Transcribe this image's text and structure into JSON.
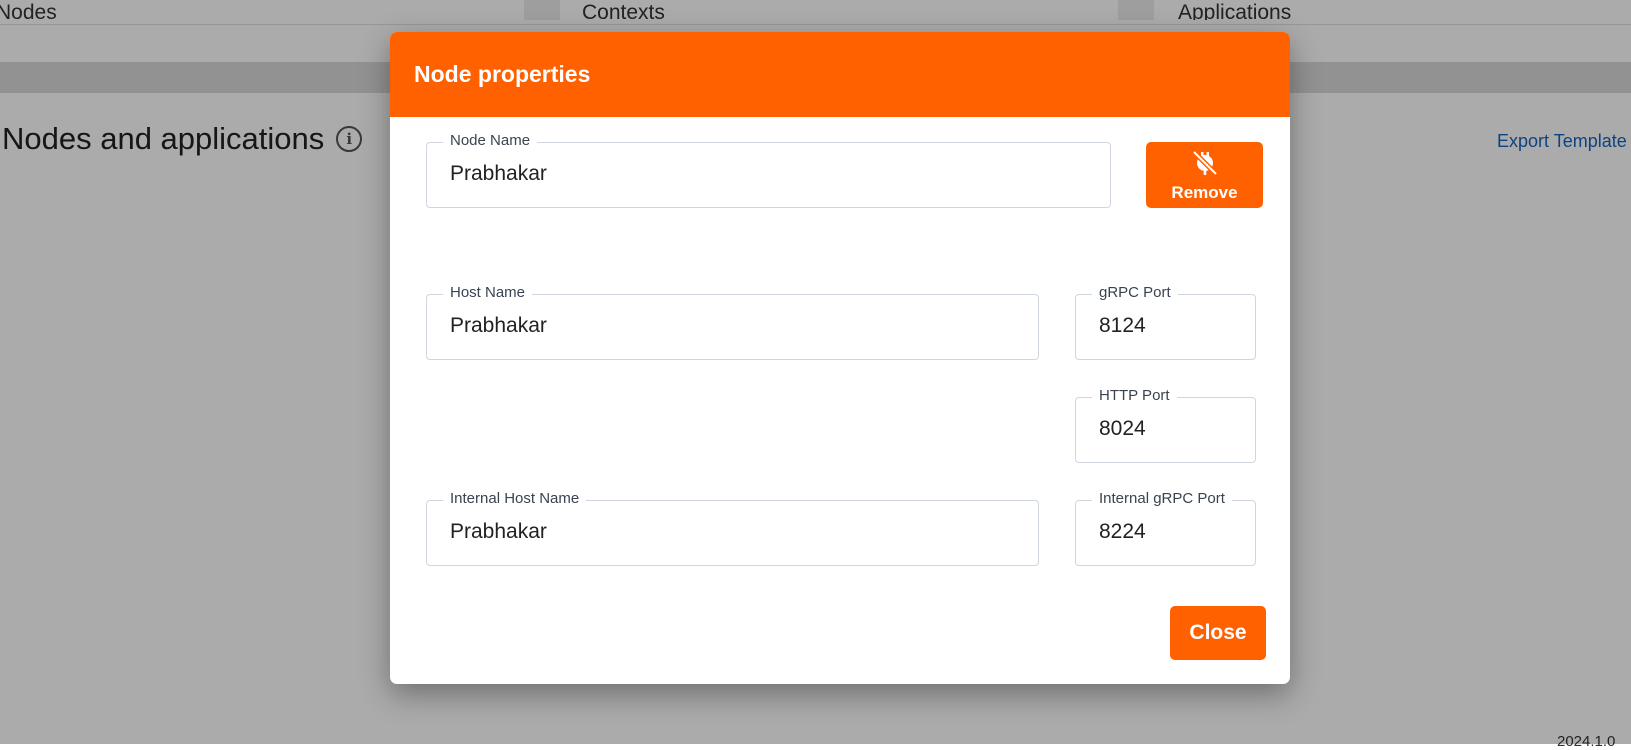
{
  "background": {
    "selectors": [
      "Nodes",
      "Contexts",
      "Applications"
    ],
    "page_title": "Nodes and applications",
    "info_icon": "info-icon",
    "export_link": "Export Template",
    "version": "2024.1.0"
  },
  "dialog": {
    "title": "Node properties",
    "remove": {
      "label": "Remove",
      "icon": "unplug-icon"
    },
    "fields": {
      "node_name": {
        "label": "Node Name",
        "value": "Prabhakar"
      },
      "host_name": {
        "label": "Host Name",
        "value": "Prabhakar"
      },
      "grpc_port": {
        "label": "gRPC Port",
        "value": "8124"
      },
      "http_port": {
        "label": "HTTP Port",
        "value": "8024"
      },
      "internal_host_name": {
        "label": "Internal Host Name",
        "value": "Prabhakar"
      },
      "internal_grpc_port": {
        "label": "Internal gRPC Port",
        "value": "8224"
      }
    },
    "close_label": "Close"
  },
  "colors": {
    "accent": "#ff6000",
    "link": "#1565c0",
    "overlay": "rgba(0,0,0,0.33)"
  }
}
